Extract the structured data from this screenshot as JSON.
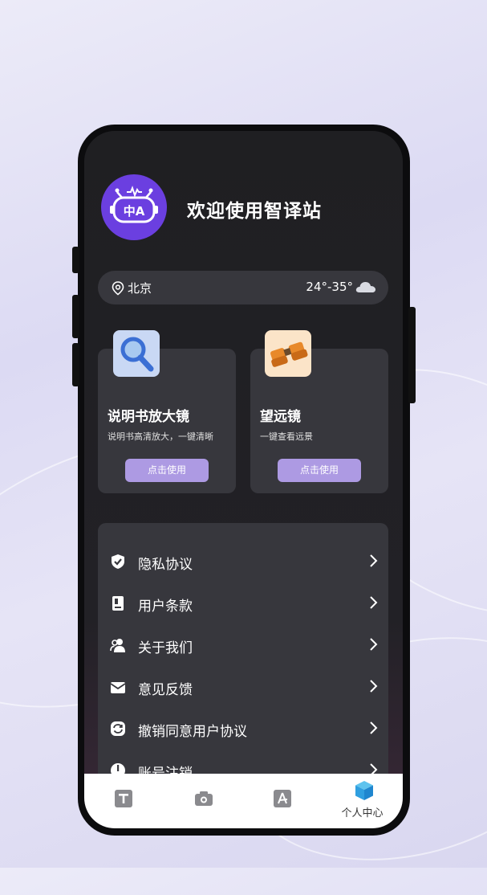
{
  "header": {
    "welcome": "欢迎使用智译站",
    "logo_text": "中A"
  },
  "weather": {
    "city": "北京",
    "temperature": "24°-35°",
    "condition_icon": "cloud-icon",
    "location_icon": "location-pin-icon"
  },
  "cards": [
    {
      "title": "说明书放大镜",
      "desc": "说明书高清放大，一键清晰",
      "button": "点击使用",
      "icon": "magnifier-icon"
    },
    {
      "title": "望远镜",
      "desc": "一键查看远景",
      "button": "点击使用",
      "icon": "binoculars-icon"
    }
  ],
  "menu": [
    {
      "label": "隐私协议",
      "icon": "shield-check-icon"
    },
    {
      "label": "用户条款",
      "icon": "document-icon"
    },
    {
      "label": "关于我们",
      "icon": "users-icon"
    },
    {
      "label": "意见反馈",
      "icon": "mail-icon"
    },
    {
      "label": "撤销同意用户协议",
      "icon": "revoke-icon"
    },
    {
      "label": "账号注销",
      "icon": "power-icon"
    }
  ],
  "tabbar": [
    {
      "icon": "text-icon"
    },
    {
      "icon": "camera-icon"
    },
    {
      "icon": "pdf-icon"
    },
    {
      "label": "个人中心",
      "icon": "cube-icon"
    }
  ],
  "colors": {
    "accent": "#6b3fe0",
    "button": "#ad9ae3",
    "card_bg": "#37373d",
    "screen_bg": "#1f1f22"
  }
}
